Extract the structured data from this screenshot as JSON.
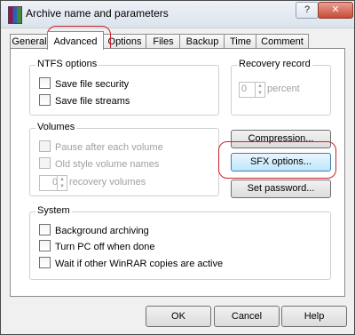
{
  "window": {
    "title": "Archive name and parameters",
    "help_button": "?",
    "close_button": "✕",
    "app_icon": "winrar-books-icon"
  },
  "tabs": [
    {
      "label": "General"
    },
    {
      "label": "Advanced",
      "active": true
    },
    {
      "label": "Options"
    },
    {
      "label": "Files"
    },
    {
      "label": "Backup"
    },
    {
      "label": "Time"
    },
    {
      "label": "Comment"
    }
  ],
  "ntfs": {
    "label": "NTFS options",
    "save_security": "Save file security",
    "save_streams": "Save file streams"
  },
  "recovery": {
    "label": "Recovery record",
    "value": "0",
    "unit": "percent"
  },
  "volumes": {
    "label": "Volumes",
    "pause": "Pause after each volume",
    "old_names": "Old style volume names",
    "recovery_value": "0",
    "recovery_unit": "recovery volumes"
  },
  "buttons": {
    "compression": "Compression...",
    "sfx": "SFX options...",
    "password": "Set password..."
  },
  "system": {
    "label": "System",
    "background": "Background archiving",
    "turn_off": "Turn PC off when done",
    "wait": "Wait if other WinRAR copies are active"
  },
  "footer": {
    "ok": "OK",
    "cancel": "Cancel",
    "help": "Help"
  },
  "colors": {
    "highlight": "#c8232c"
  }
}
